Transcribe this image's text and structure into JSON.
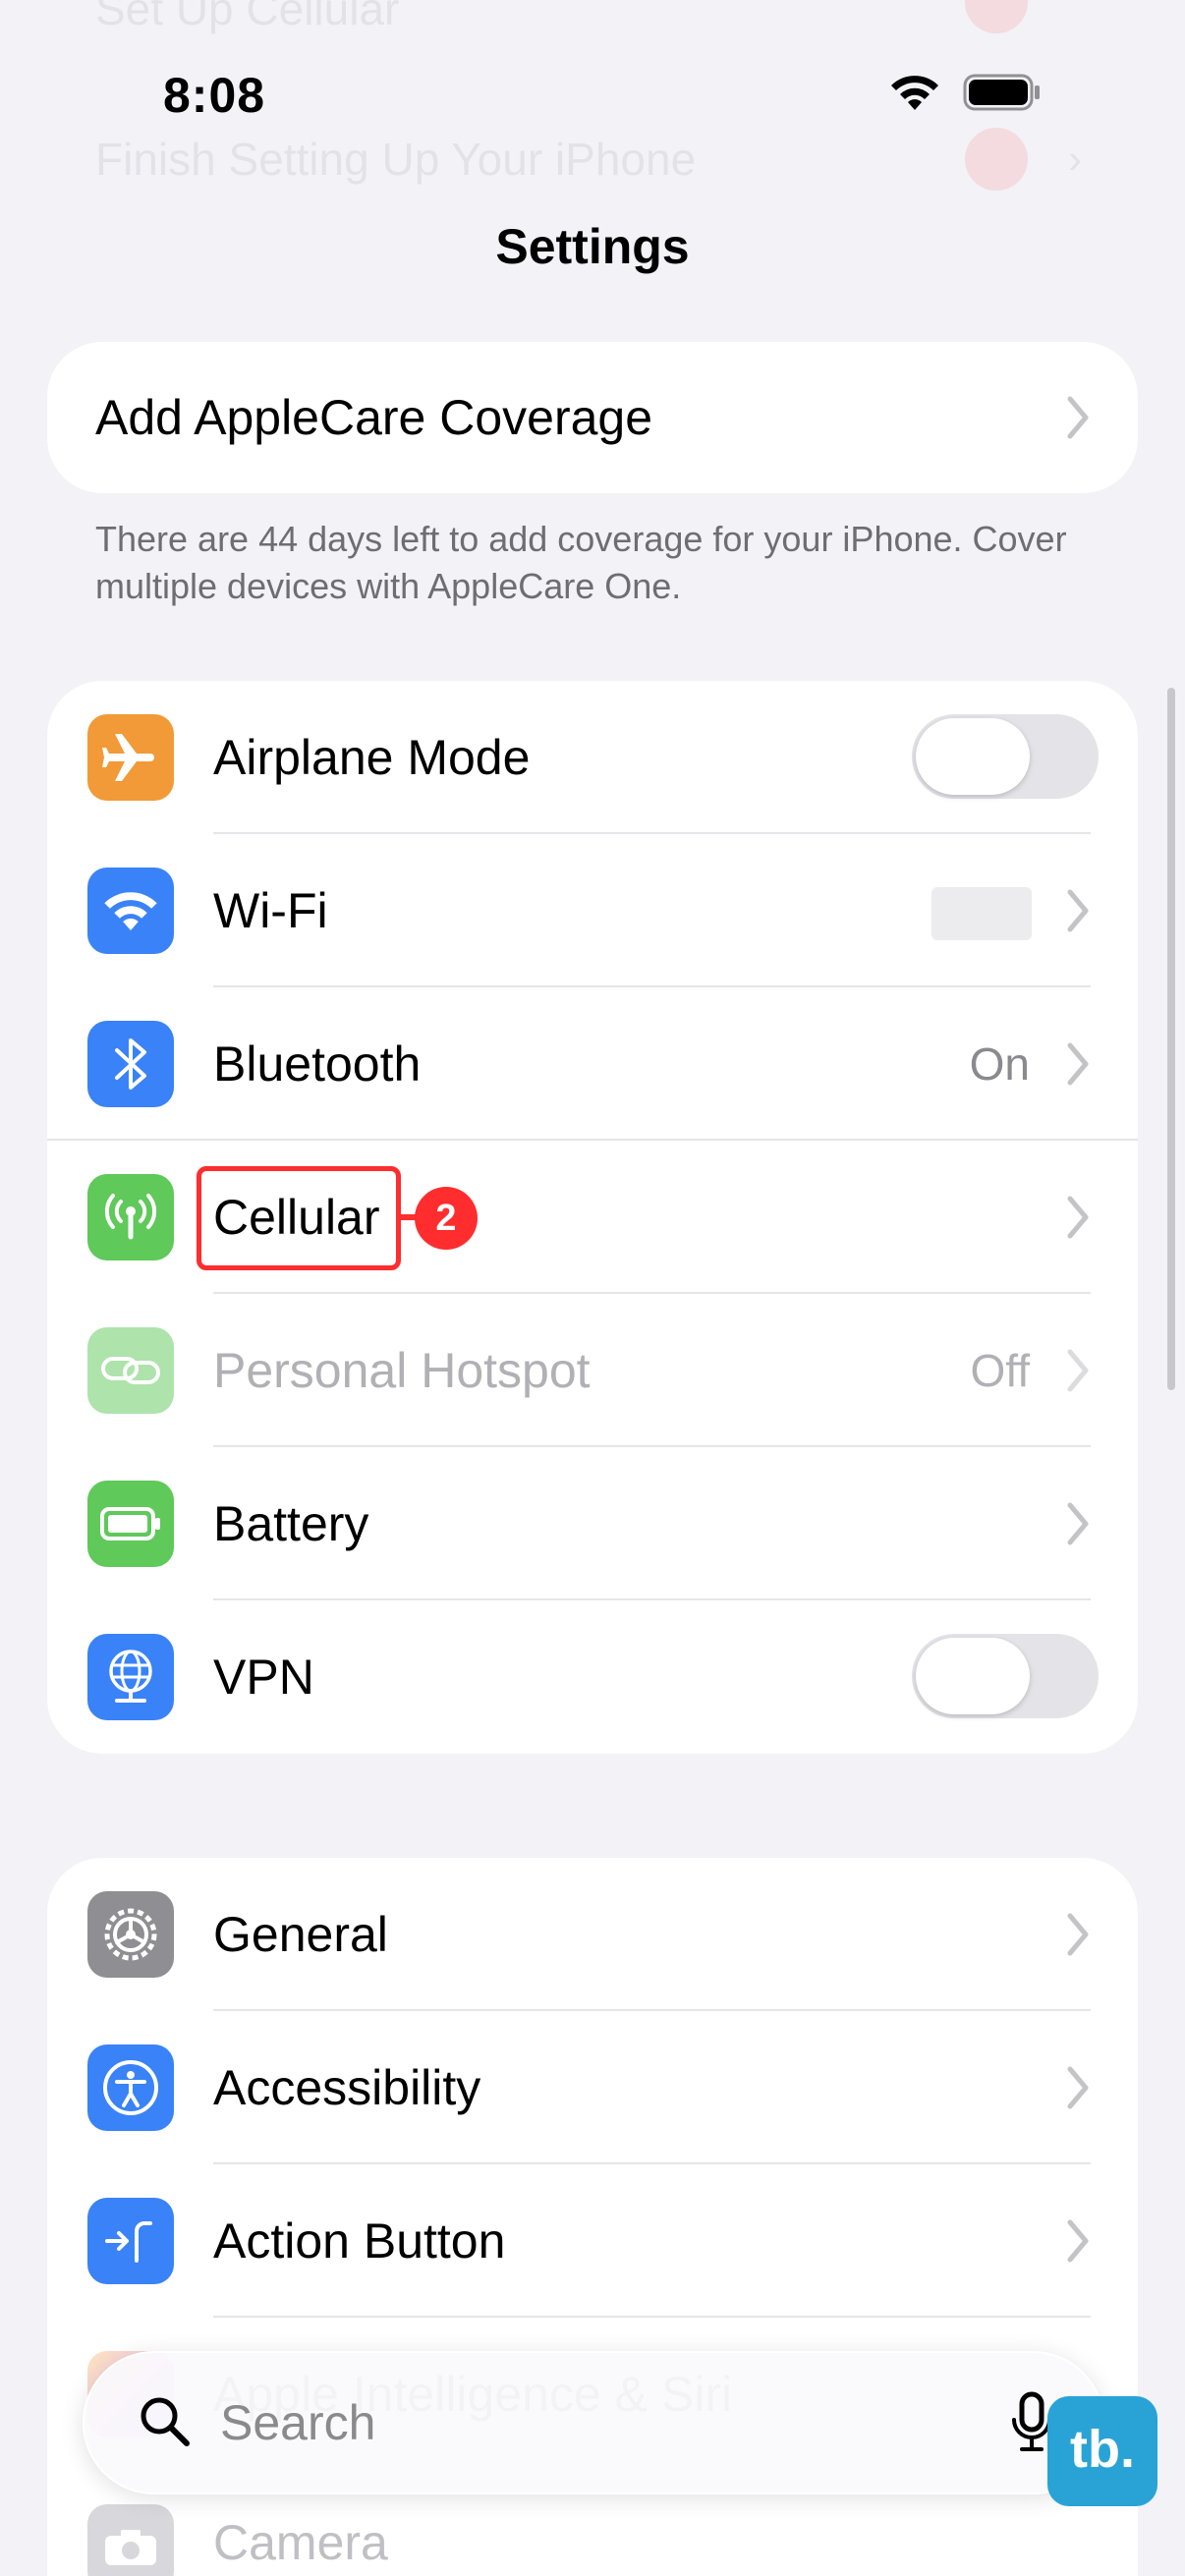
{
  "background_ghosts": {
    "row1": "Set Up Cellular",
    "row2": "Finish Setting Up Your iPhone"
  },
  "status_bar": {
    "time": "8:08"
  },
  "nav": {
    "title": "Settings"
  },
  "applecare": {
    "label": "Add AppleCare Coverage",
    "footnote": "There are 44 days left to add coverage for your iPhone. Cover multiple devices with AppleCare One."
  },
  "connectivity": [
    {
      "label": "Airplane Mode",
      "icon": "airplane-icon",
      "color": "#f19a37",
      "control": "toggle",
      "on": false
    },
    {
      "label": "Wi-Fi",
      "icon": "wifi-icon",
      "color": "#3a82f7",
      "control": "chevron",
      "value": ""
    },
    {
      "label": "Bluetooth",
      "icon": "bluetooth-icon",
      "color": "#3a82f7",
      "control": "chevron",
      "value": "On"
    },
    {
      "label": "Cellular",
      "icon": "antenna-icon",
      "color": "#5fc95a",
      "control": "chevron",
      "value": ""
    },
    {
      "label": "Personal Hotspot",
      "icon": "link-icon",
      "color": "#5fc95a",
      "control": "chevron",
      "value": "Off",
      "disabled": true
    },
    {
      "label": "Battery",
      "icon": "battery-icon",
      "color": "#5fc95a",
      "control": "chevron",
      "value": ""
    },
    {
      "label": "VPN",
      "icon": "globe-icon",
      "color": "#3a82f7",
      "control": "toggle",
      "on": false
    }
  ],
  "general": [
    {
      "label": "General",
      "icon": "gear-icon",
      "color": "#8e8e93"
    },
    {
      "label": "Accessibility",
      "icon": "accessibility-icon",
      "color": "#3a82f7"
    },
    {
      "label": "Action Button",
      "icon": "action-button-icon",
      "color": "#3a82f7"
    },
    {
      "label": "Apple Intelligence & Siri",
      "icon": "siri-icon",
      "color": "#e56bd0"
    }
  ],
  "bottom_peek": {
    "label": "Camera"
  },
  "annotation": {
    "step": "2"
  },
  "search": {
    "placeholder": "Search"
  },
  "watermark": {
    "text": "tb."
  }
}
